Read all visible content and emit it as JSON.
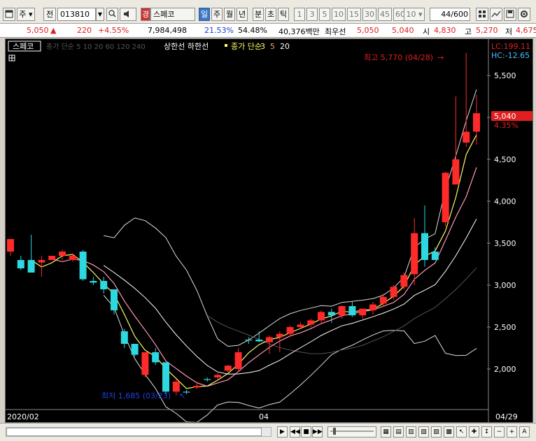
{
  "toolbar": {
    "market_label": "주",
    "jeon_label": "전",
    "code_value": "013810",
    "name_badge": "경",
    "name_value": "스페코",
    "periods": [
      "일",
      "주",
      "월",
      "년",
      "분",
      "초",
      "틱"
    ],
    "active_period": "일",
    "intervals": [
      "1",
      "3",
      "5",
      "10",
      "15",
      "30",
      "45",
      "60"
    ],
    "interval_select": "10",
    "count_value": "44",
    "count_total": "/600"
  },
  "info": {
    "price": "5,050",
    "arrow": "▲",
    "change": "220",
    "change_pct": "+4.55%",
    "volume": "7,984,498",
    "turnover_pct": "21.53%",
    "ratio_pct": "54.48%",
    "amount": "40,376백만",
    "broker_label": "최우선",
    "best_ask": "5,050",
    "best_bid": "5,040",
    "open_label": "시",
    "open": "4,830",
    "high_label": "고",
    "high": "5,270",
    "low_label": "저",
    "low": "4,675"
  },
  "legend": {
    "title": "스페코",
    "ma_label": "종가 단순 5 10 20 60 120 240",
    "band_label": "상한선 하한선",
    "ma2_label": "종가 단순",
    "ma2_periods": [
      "3",
      "5",
      "20"
    ]
  },
  "annotations": {
    "max_label": "최고 5,770 (04/28)",
    "min_label": "최저 1,685 (03/23)"
  },
  "scale": {
    "lc": "LC:199.11",
    "hc": "HC:-12.65",
    "current_price": "5,040",
    "current_pct": "4.35%"
  },
  "dates": [
    "2020/02",
    "04",
    "04/29"
  ],
  "chart_data": {
    "type": "candlestick",
    "ylim": [
      1600,
      5850
    ],
    "y_ticks": [
      2000,
      2500,
      3000,
      3500,
      4000,
      4500,
      5000,
      5500
    ],
    "y_tick_labels": [
      "2,000",
      "2,500",
      "3,000",
      "3,500",
      "4,000",
      "4,500",
      "5,000",
      "5,500"
    ],
    "candles": [
      {
        "o": 3400,
        "h": 3550,
        "l": 3350,
        "c": 3550
      },
      {
        "o": 3300,
        "h": 3350,
        "l": 3180,
        "c": 3200
      },
      {
        "o": 3300,
        "h": 3600,
        "l": 3180,
        "c": 3150
      },
      {
        "o": 3270,
        "h": 3350,
        "l": 3100,
        "c": 3300
      },
      {
        "o": 3300,
        "h": 3350,
        "l": 3300,
        "c": 3350
      },
      {
        "o": 3350,
        "h": 3420,
        "l": 3300,
        "c": 3400
      },
      {
        "o": 3300,
        "h": 3380,
        "l": 3280,
        "c": 3350
      },
      {
        "o": 3400,
        "h": 3420,
        "l": 3050,
        "c": 3070
      },
      {
        "o": 3050,
        "h": 3100,
        "l": 3000,
        "c": 3030
      },
      {
        "o": 3050,
        "h": 3100,
        "l": 2900,
        "c": 2950
      },
      {
        "o": 2950,
        "h": 2950,
        "l": 2650,
        "c": 2700
      },
      {
        "o": 2450,
        "h": 2480,
        "l": 2250,
        "c": 2300
      },
      {
        "o": 2300,
        "h": 2300,
        "l": 2150,
        "c": 2170
      },
      {
        "o": 1930,
        "h": 2200,
        "l": 1900,
        "c": 2200
      },
      {
        "o": 2200,
        "h": 2250,
        "l": 2050,
        "c": 2080
      },
      {
        "o": 2080,
        "h": 2080,
        "l": 1700,
        "c": 1730
      },
      {
        "o": 1730,
        "h": 1880,
        "l": 1685,
        "c": 1850
      },
      {
        "o": 1730,
        "h": 1750,
        "l": 1700,
        "c": 1720
      },
      {
        "o": 1780,
        "h": 1850,
        "l": 1760,
        "c": 1800
      },
      {
        "o": 1880,
        "h": 1900,
        "l": 1850,
        "c": 1870
      },
      {
        "o": 1900,
        "h": 1950,
        "l": 1880,
        "c": 1930
      },
      {
        "o": 1980,
        "h": 2050,
        "l": 1960,
        "c": 2040
      },
      {
        "o": 2000,
        "h": 2250,
        "l": 1960,
        "c": 2200
      },
      {
        "o": 2350,
        "h": 2380,
        "l": 2300,
        "c": 2340
      },
      {
        "o": 2350,
        "h": 2450,
        "l": 2320,
        "c": 2330
      },
      {
        "o": 2320,
        "h": 2400,
        "l": 2180,
        "c": 2380
      },
      {
        "o": 2380,
        "h": 2450,
        "l": 2200,
        "c": 2420
      },
      {
        "o": 2420,
        "h": 2520,
        "l": 2380,
        "c": 2500
      },
      {
        "o": 2500,
        "h": 2560,
        "l": 2480,
        "c": 2530
      },
      {
        "o": 2530,
        "h": 2600,
        "l": 2500,
        "c": 2580
      },
      {
        "o": 2580,
        "h": 2700,
        "l": 2550,
        "c": 2680
      },
      {
        "o": 2680,
        "h": 2720,
        "l": 2550,
        "c": 2640
      },
      {
        "o": 2640,
        "h": 2760,
        "l": 2600,
        "c": 2750
      },
      {
        "o": 2750,
        "h": 2800,
        "l": 2620,
        "c": 2640
      },
      {
        "o": 2640,
        "h": 2720,
        "l": 2600,
        "c": 2720
      },
      {
        "o": 2700,
        "h": 2800,
        "l": 2650,
        "c": 2770
      },
      {
        "o": 2780,
        "h": 2900,
        "l": 2750,
        "c": 2860
      },
      {
        "o": 2860,
        "h": 3000,
        "l": 2820,
        "c": 2980
      },
      {
        "o": 2980,
        "h": 3150,
        "l": 2950,
        "c": 3120
      },
      {
        "o": 3130,
        "h": 3800,
        "l": 3000,
        "c": 3620
      },
      {
        "o": 3620,
        "h": 3950,
        "l": 3220,
        "c": 3300
      },
      {
        "o": 3400,
        "h": 3450,
        "l": 3300,
        "c": 3300
      },
      {
        "o": 3750,
        "h": 4350,
        "l": 3700,
        "c": 4340
      },
      {
        "o": 4200,
        "h": 5250,
        "l": 4200,
        "c": 4500
      },
      {
        "o": 4700,
        "h": 5770,
        "l": 4650,
        "c": 4830
      },
      {
        "o": 4830,
        "h": 5270,
        "l": 4675,
        "c": 5050
      }
    ]
  }
}
